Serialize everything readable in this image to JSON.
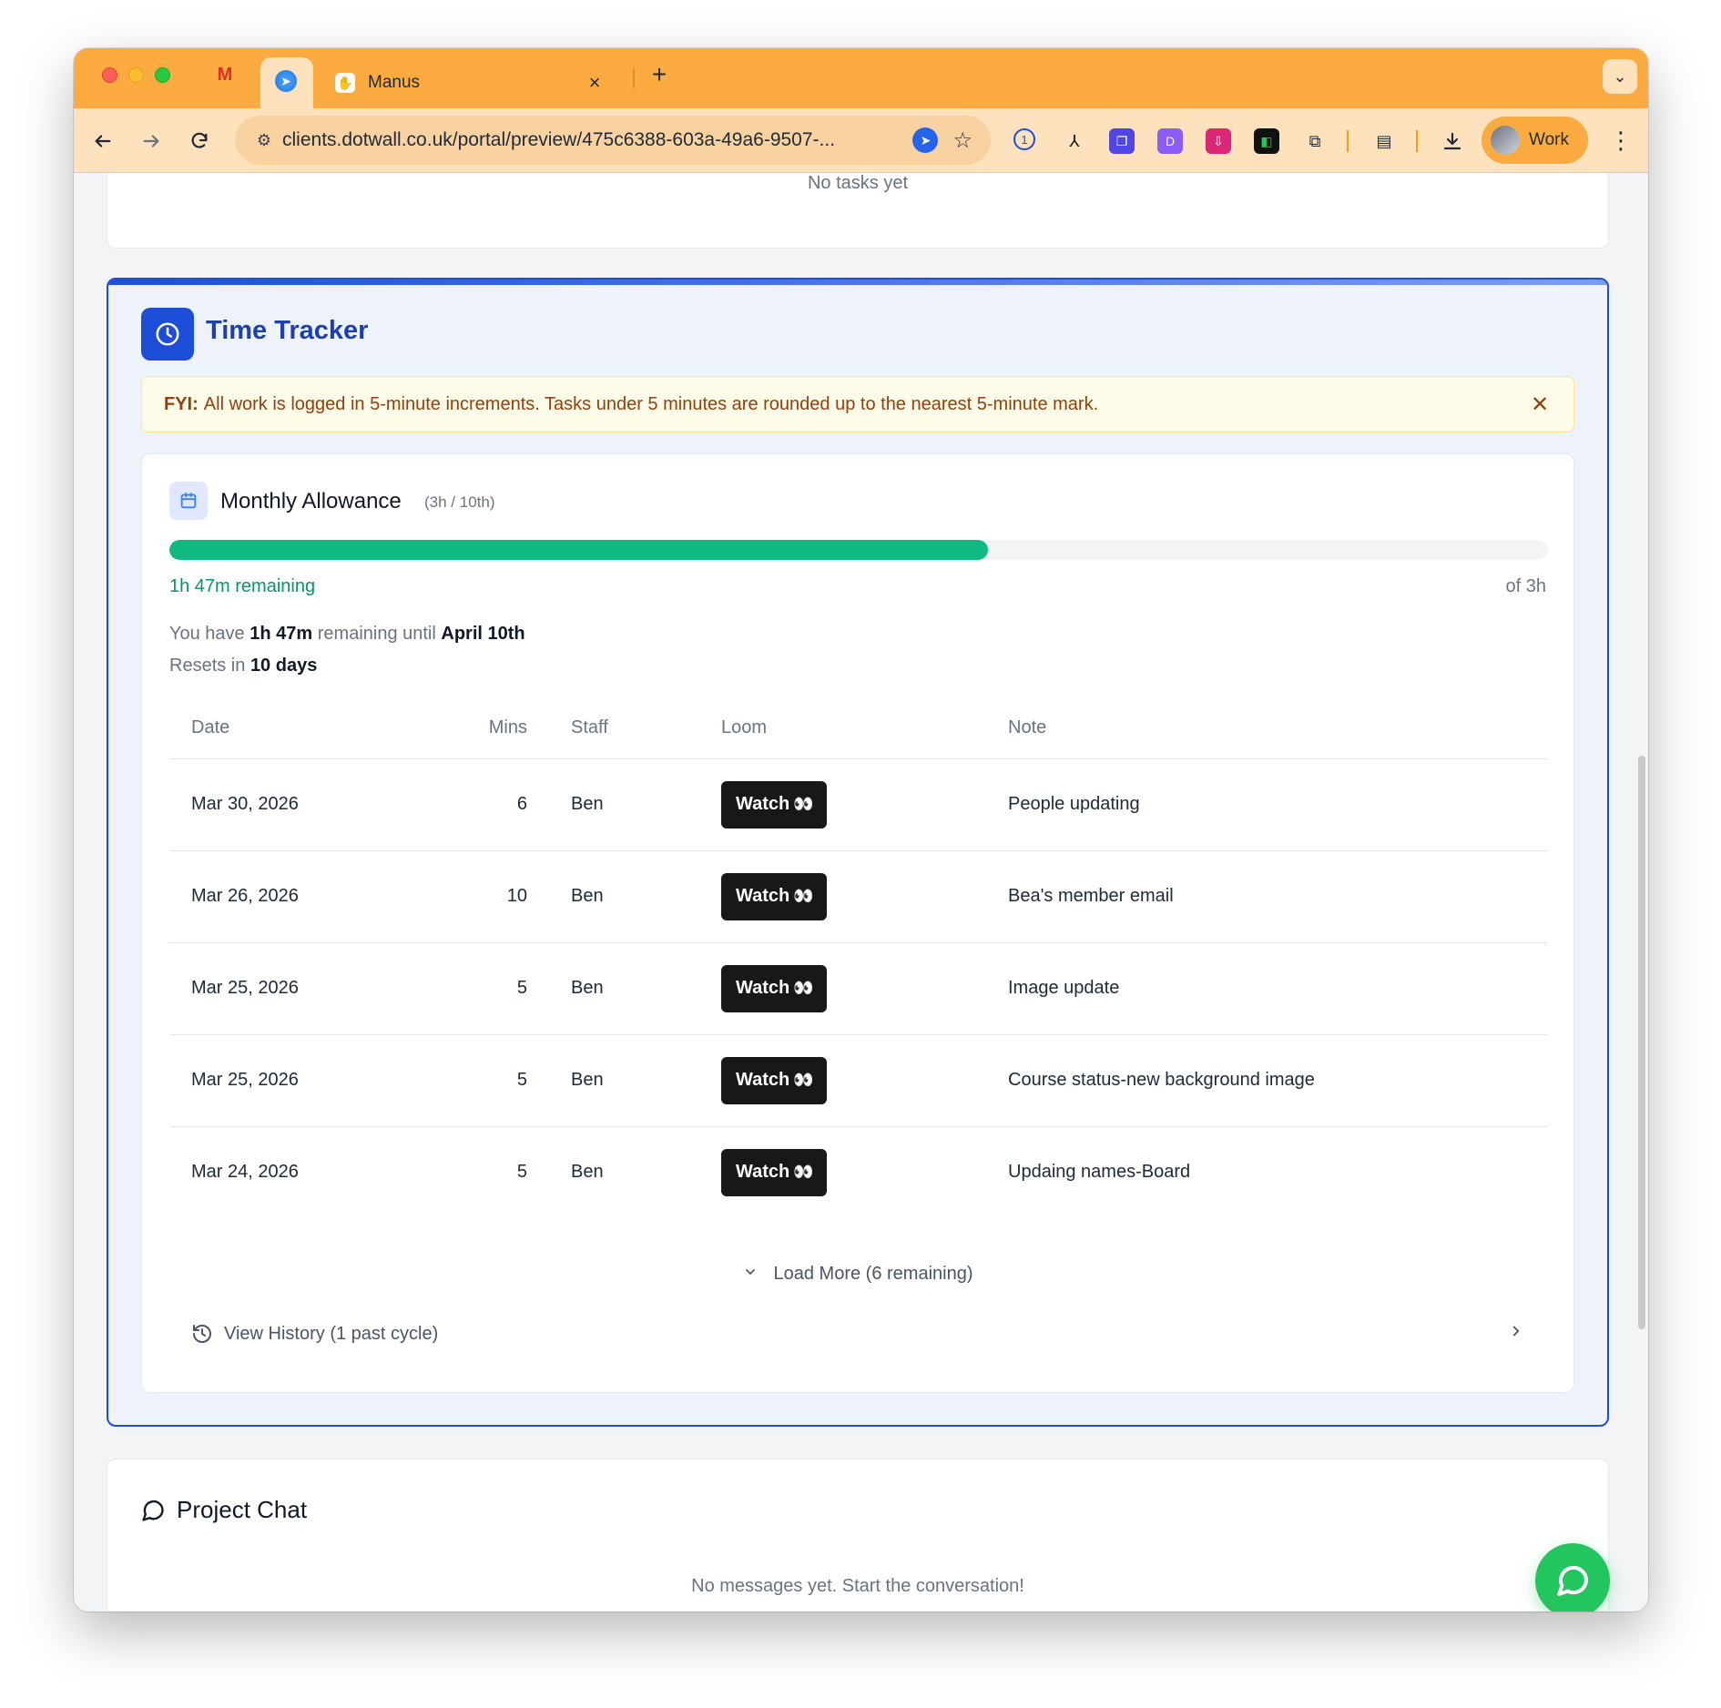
{
  "browser": {
    "tabs": {
      "active_title": "Manus",
      "close_symbol": "×",
      "new_tab_symbol": "+"
    },
    "url": "clients.dotwall.co.uk/portal/preview/475c6388-603a-49a6-9507-...",
    "profile_label": "Work"
  },
  "tasks": {
    "empty_text": "No tasks yet"
  },
  "time_tracker": {
    "title": "Time Tracker",
    "fyi_label": "FYI:",
    "fyi_text": "All work is logged in 5-minute increments. Tasks under 5 minutes are rounded up to the nearest 5-minute mark.",
    "allowance": {
      "title": "Monthly Allowance",
      "subtitle": "(3h / 10th)",
      "progress_fraction": 0.594,
      "progress_color": "#10b981",
      "remaining_label": "1h 47m remaining",
      "of_total": "of 3h",
      "info_prefix": "You have",
      "info_remaining": "1h 47m",
      "info_middle": "remaining until",
      "info_date": "April 10th",
      "resets_prefix": "Resets in",
      "resets_value": "10 days"
    },
    "table": {
      "columns": [
        "Date",
        "Mins",
        "Staff",
        "Loom",
        "Note"
      ],
      "watch_label": "Watch",
      "watch_eyes": "👀",
      "rows": [
        {
          "date": "Mar 30, 2026",
          "mins": "6",
          "staff": "Ben",
          "note": "People updating"
        },
        {
          "date": "Mar 26, 2026",
          "mins": "10",
          "staff": "Ben",
          "note": "Bea's member email"
        },
        {
          "date": "Mar 25, 2026",
          "mins": "5",
          "staff": "Ben",
          "note": "Image update"
        },
        {
          "date": "Mar 25, 2026",
          "mins": "5",
          "staff": "Ben",
          "note": "Course status-new background image"
        },
        {
          "date": "Mar 24, 2026",
          "mins": "5",
          "staff": "Ben",
          "note": "Updaing names-Board"
        }
      ]
    },
    "load_more": "Load More (6 remaining)",
    "view_history": "View History (1 past cycle)"
  },
  "chat": {
    "title": "Project Chat",
    "empty_text": "No messages yet. Start the conversation!"
  },
  "colors": {
    "accent_blue": "#1d4ed8",
    "browser_orange": "#fbab3f",
    "chat_fab": "#22c55e"
  }
}
